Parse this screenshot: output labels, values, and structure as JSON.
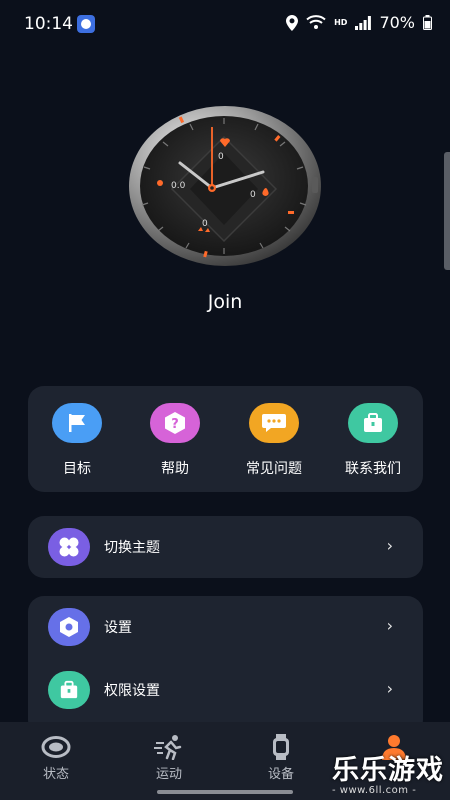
{
  "status_bar": {
    "time": "10:14",
    "hd": "HD",
    "battery": "70%"
  },
  "watch_face": {
    "dial_values": [
      "0",
      "0.0",
      "0",
      "0"
    ]
  },
  "profile": {
    "name": "Join"
  },
  "quick_actions": [
    {
      "label": "目标",
      "icon": "flag-icon",
      "color": "#4a9ef5"
    },
    {
      "label": "帮助",
      "icon": "question-icon",
      "color": "#d663d8"
    },
    {
      "label": "常见问题",
      "icon": "chat-bubble-icon",
      "color": "#f2a623"
    },
    {
      "label": "联系我们",
      "icon": "briefcase-icon",
      "color": "#3fc8a1"
    }
  ],
  "theme_row": {
    "label": "切换主题",
    "icon": "clover-icon",
    "color": "#7a5fe3"
  },
  "settings_rows": [
    {
      "label": "设置",
      "icon": "hex-nut-icon",
      "color": "#6670e8"
    },
    {
      "label": "权限设置",
      "icon": "briefcase-icon",
      "color": "#3fc8a1"
    }
  ],
  "tabs": [
    {
      "label": "状态",
      "icon": "ring-icon"
    },
    {
      "label": "运动",
      "icon": "runner-icon"
    },
    {
      "label": "设备",
      "icon": "watch-icon"
    },
    {
      "label": "",
      "icon": "person-icon",
      "active_color": "#ff7a2e"
    }
  ],
  "watermark": {
    "title": "乐乐游戏",
    "url": "- www.6ll.com -"
  }
}
